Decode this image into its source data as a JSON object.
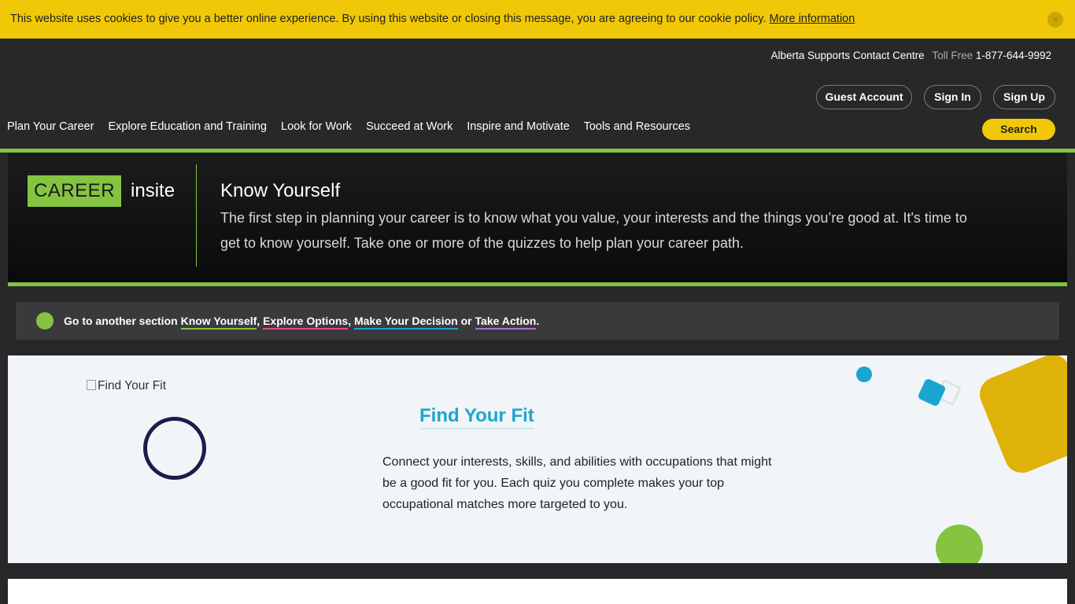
{
  "cookie_banner": {
    "message": "This website uses cookies to give you a better online experience. By using this website or closing this message, you are agreeing to our cookie policy.",
    "link": "More information",
    "close_icon": "×"
  },
  "header": {
    "contact_label": "Alberta Supports Contact Centre",
    "toll_free_label": "Toll Free",
    "phone": "1-877-644-9992",
    "guest_account": "Guest Account",
    "sign_in": "Sign In",
    "sign_up": "Sign Up",
    "nav": [
      "Plan Your Career",
      "Explore Education and Training",
      "Look for Work",
      "Succeed at Work",
      "Inspire and Motivate",
      "Tools and Resources"
    ],
    "search": "Search"
  },
  "hero": {
    "logo_career": "CAREER",
    "logo_insite": "insite",
    "title": "Know Yourself",
    "description": "The first step in planning your career is to know what you value, your interests and the things you’re good at. It's time to get to know yourself. Take one or more of the quizzes to help plan your career path."
  },
  "section_nav": {
    "prefix": "Go to another section",
    "links": [
      "Know Yourself",
      "Explore Options",
      "Make Your Decision",
      "Take Action"
    ],
    "sep1": ",",
    "sep2": ",",
    "or": "or",
    "end": "."
  },
  "find_fit": {
    "image_alt": "Find Your Fit",
    "title": "Find Your Fit",
    "description": "Connect your interests, skills, and abilities with occupations that might be a good fit for you. Each quiz you complete makes your top occupational matches more targeted to you."
  },
  "colors": {
    "accent_yellow": "#f0c808",
    "accent_green": "#84c441",
    "accent_blue": "#1ba6d1",
    "background": "#28282b"
  }
}
